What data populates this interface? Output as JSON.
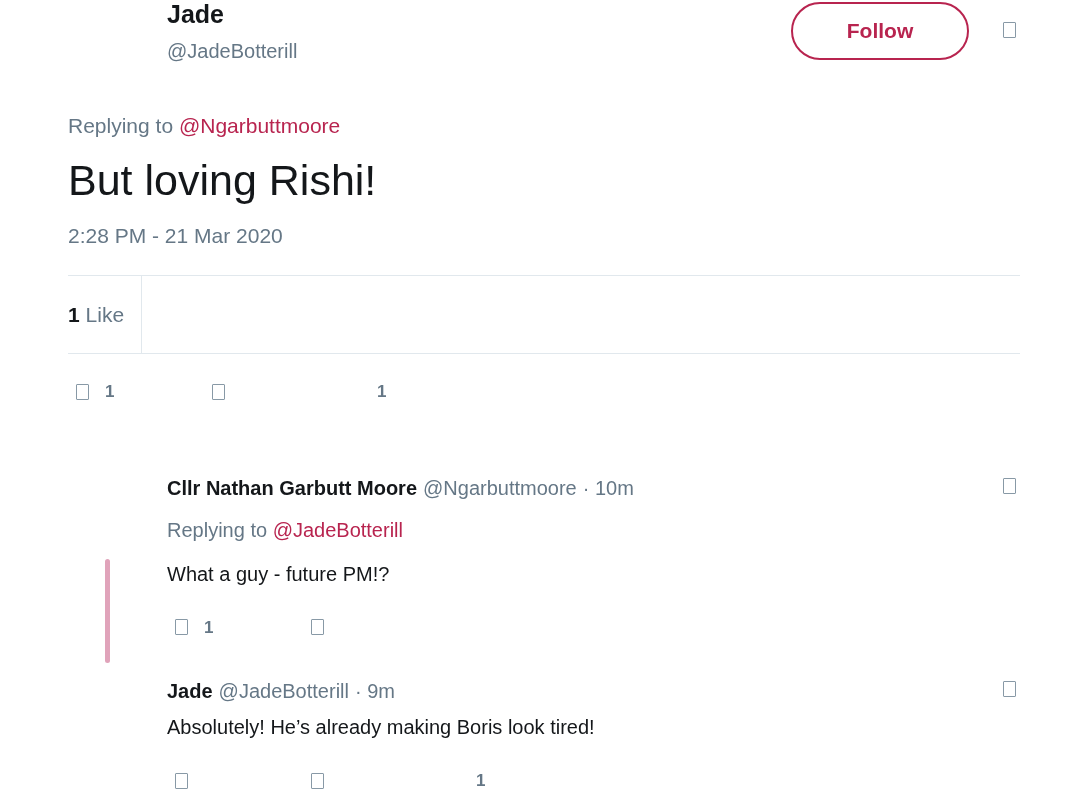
{
  "tweet": {
    "name": "Jade",
    "handle": "@JadeBotterill",
    "follow_label": "Follow",
    "replying_label": "Replying to",
    "replying_to": "@Ngarbuttmoore",
    "text": "But loving Rishi!",
    "timestamp": "2:28 PM - 21 Mar 2020",
    "stats": [
      {
        "count": "1",
        "label": "Like"
      }
    ],
    "actions": [
      {
        "kind": "icon-count",
        "count": "1"
      },
      {
        "kind": "icon"
      },
      {
        "kind": "count",
        "count": "1"
      }
    ]
  },
  "replies": [
    {
      "name": "Cllr Nathan Garbutt Moore",
      "handle": "@Ngarbuttmoore",
      "time": "· 10m",
      "replying_label": "Replying to",
      "replying_to": "@JadeBotterill",
      "text": "What a guy - future PM!?",
      "thread_line": true,
      "actions": [
        {
          "kind": "icon-count",
          "count": "1"
        },
        {
          "kind": "icon"
        }
      ]
    },
    {
      "name": "Jade",
      "handle": "@JadeBotterill",
      "time": "· 9m",
      "text": "Absolutely! He’s already making Boris look tired!",
      "thread_line": false,
      "actions": [
        {
          "kind": "icon"
        },
        {
          "kind": "icon"
        },
        {
          "kind": "count",
          "count": "1"
        }
      ]
    }
  ]
}
